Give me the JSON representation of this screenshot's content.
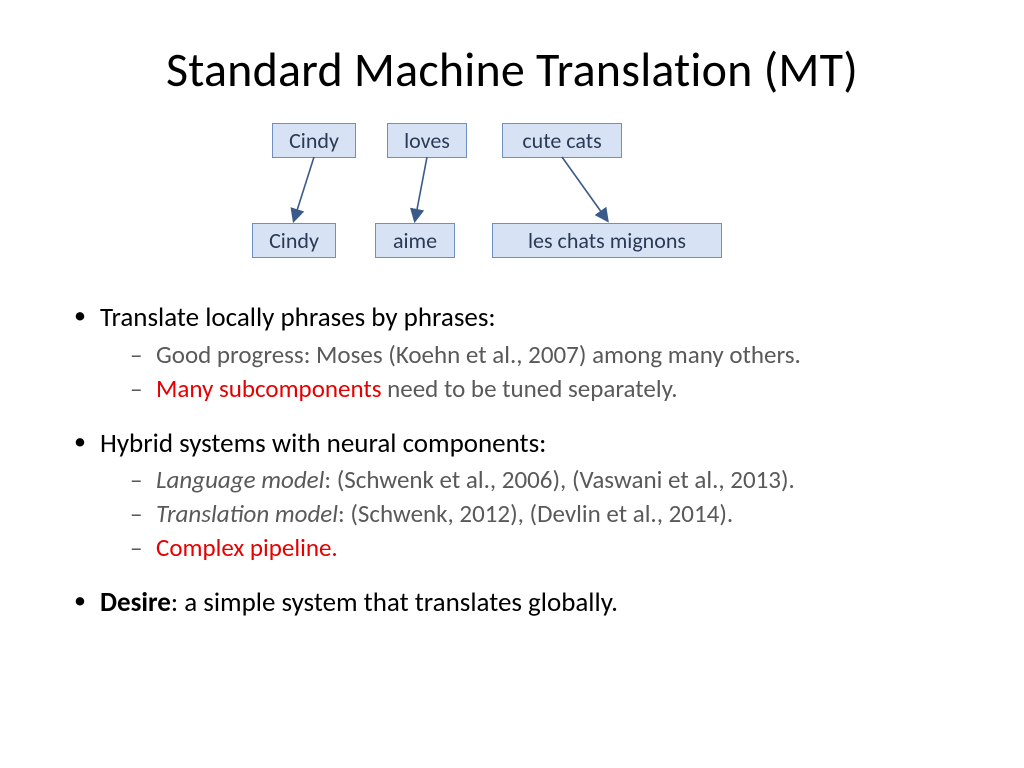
{
  "title": "Standard Machine Translation (MT)",
  "diagram": {
    "src": {
      "w1": "Cindy",
      "w2": "loves",
      "w3": "cute cats"
    },
    "tgt": {
      "w1": "Cindy",
      "w2": "aime",
      "w3": "les chats mignons"
    }
  },
  "bullets": {
    "b1": {
      "head": "Translate locally phrases by phrases:",
      "sub1": "Good progress: Moses (Koehn et al., 2007) among many others.",
      "sub2_em": "Many subcomponents",
      "sub2_rest": " need to be tuned separately."
    },
    "b2": {
      "head": "Hybrid systems with neural components:",
      "sub1_label": "Language model",
      "sub1_rest": ": (Schwenk et al., 2006), (Vaswani et al., 2013).",
      "sub2_label": "Translation model",
      "sub2_rest": ": (Schwenk, 2012), (Devlin et al., 2014).",
      "sub3_em": "Complex pipeline",
      "sub3_rest": "."
    },
    "b3": {
      "bold": "Desire",
      "rest": ": a simple system that translates globally."
    }
  }
}
